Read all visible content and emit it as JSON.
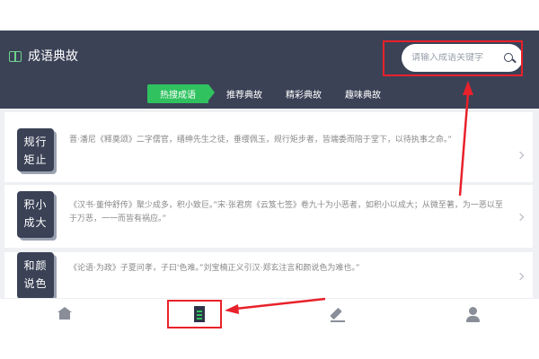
{
  "header": {
    "title": "成语典故",
    "search": {
      "placeholder": "请输入成语关键字",
      "value": ""
    },
    "tabs": [
      {
        "label": "热搜成语",
        "active": true
      },
      {
        "label": "推荐典故",
        "active": false
      },
      {
        "label": "精彩典故",
        "active": false
      },
      {
        "label": "趣味典故",
        "active": false
      }
    ]
  },
  "idioms": [
    {
      "line1": "规行",
      "line2": "矩止",
      "text": "晋·潘尼《释奠颂》二字儒官，缙绅先生之徒，垂缨佩玉，规行矩步者，皆端委而陪于堂下，以待执事之命。”"
    },
    {
      "line1": "积小",
      "line2": "成大",
      "text": "《汉书·董仲舒传》聚少成多，积小致巨。”宋·张君房《云笈七签》卷九十为小恶者，如积小以成大；从微至著，为一恶以至于万恶，一一而皆有祸应。”"
    },
    {
      "line1": "和颜",
      "line2": "说色",
      "text": "《论语·为政》子夏问孝，子曰'色难。”刘宝楠正义引汉·郑玄注言和颜说色为难也。”"
    }
  ],
  "bottom_nav": [
    {
      "icon": "home-icon",
      "active": false
    },
    {
      "icon": "document-icon",
      "active": true
    },
    {
      "icon": "edit-icon",
      "active": false
    },
    {
      "icon": "user-icon",
      "active": false
    }
  ],
  "colors": {
    "header_bg": "#3b4256",
    "accent_green": "#2fc25f",
    "annotation_red": "#e8212a",
    "list_bg": "#eef0f3"
  }
}
